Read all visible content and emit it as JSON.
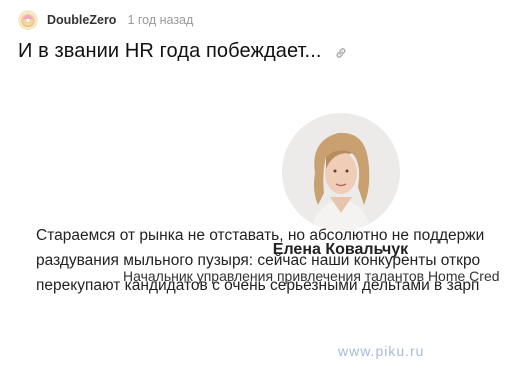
{
  "post": {
    "author": "DoubleZero",
    "time": "1 год назад",
    "title": "И в звании HR года побеждает..."
  },
  "icons": {
    "avatar": "doughnut-emoji-icon",
    "link": "link-icon"
  },
  "article": {
    "person_name": "Елена Ковальчук",
    "person_role": "Начальник управления привлечения талантов Home Cred",
    "lines": [
      "Стараемся от рынка не отставать, но абсолютно не поддержи",
      "раздувания мыльного пузыря: сейчас наши конкуренты откро",
      "перекупают кандидатов с очень серьезными дельтами в зарп"
    ],
    "watermark": "www.piku.ru"
  },
  "colors": {
    "author": "#333333",
    "time": "#999999",
    "link_icon": "#b5b5b5",
    "avatar_bg": "#f6e9c9"
  }
}
